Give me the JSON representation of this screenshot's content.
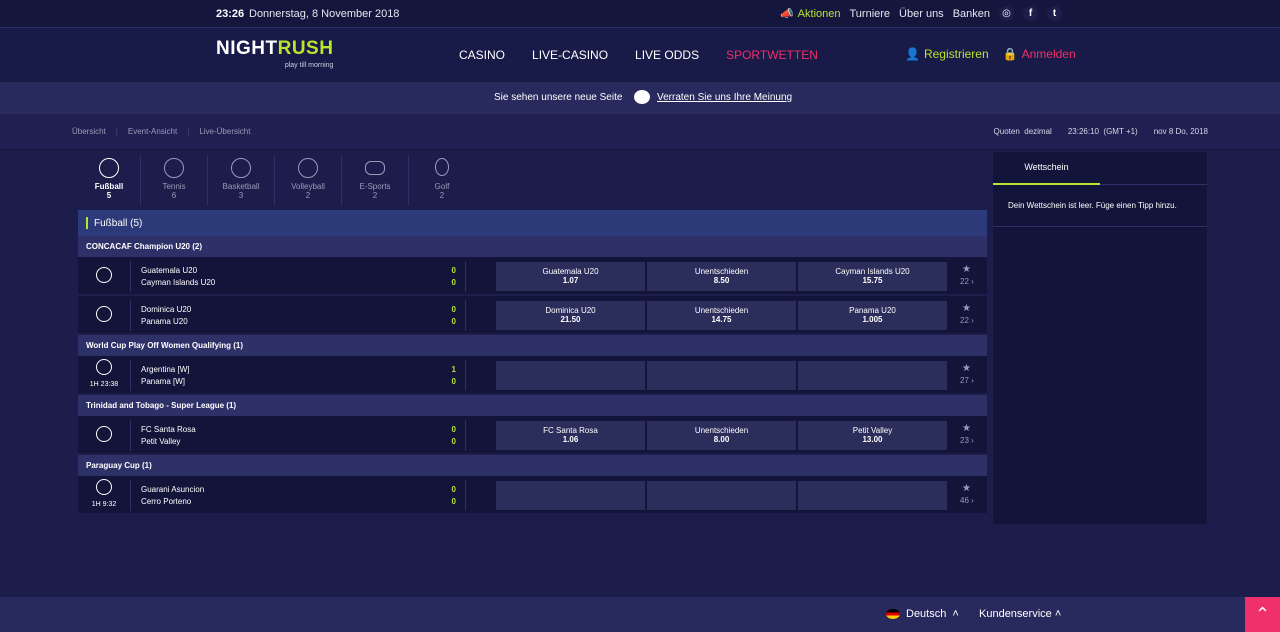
{
  "topbar": {
    "time": "23:26",
    "date": "Donnerstag, 8 November 2018",
    "links": {
      "aktionen": "Aktionen",
      "turniere": "Turniere",
      "ueber_uns": "Über uns",
      "banken": "Banken"
    }
  },
  "header": {
    "logo_night": "NIGHT",
    "logo_rush": "RUSH",
    "tagline": "play till morning",
    "nav": [
      "CASINO",
      "LIVE-CASINO",
      "LIVE ODDS",
      "SPORTWETTEN"
    ],
    "register": "Registrieren",
    "login": "Anmelden"
  },
  "notice": {
    "message": "Sie sehen unsere neue Seite",
    "feedback": "Verraten Sie uns Ihre Meinung"
  },
  "subnav": {
    "crumbs": [
      "Übersicht",
      "Event-Ansicht",
      "Live-Übersicht"
    ],
    "quoten": "Quoten",
    "format": "dezimal",
    "clock": "23:26:10",
    "tz": "(GMT +1)",
    "date": "nov 8 Do, 2018"
  },
  "sports": [
    {
      "label": "Fußball",
      "count": "5"
    },
    {
      "label": "Tennis",
      "count": "6"
    },
    {
      "label": "Basketball",
      "count": "3"
    },
    {
      "label": "Volleyball",
      "count": "2"
    },
    {
      "label": "E-Sports",
      "count": "2"
    },
    {
      "label": "Golf",
      "count": "2"
    }
  ],
  "section_title": "Fußball (5)",
  "competitions": {
    "c1": "CONCACAF Champion U20 (2)",
    "c2": "World Cup Play Off Women Qualifying (1)",
    "c3": "Trinidad and Tobago - Super League (1)",
    "c4": "Paraguay Cup (1)"
  },
  "events": [
    {
      "home": "Guatemala U20",
      "away": "Cayman Islands U20",
      "s1": "0",
      "s2": "0",
      "clock": "",
      "odds": [
        {
          "n": "Guatemala U20",
          "v": "1.07"
        },
        {
          "n": "Unentschieden",
          "v": "8.50"
        },
        {
          "n": "Cayman Islands U20",
          "v": "15.75"
        }
      ],
      "more": "22"
    },
    {
      "home": "Dominica U20",
      "away": "Panama U20",
      "s1": "0",
      "s2": "0",
      "clock": "",
      "odds": [
        {
          "n": "Dominica U20",
          "v": "21.50"
        },
        {
          "n": "Unentschieden",
          "v": "14.75"
        },
        {
          "n": "Panama U20",
          "v": "1.005"
        }
      ],
      "more": "22"
    },
    {
      "home": "Argentina [W]",
      "away": "Panama [W]",
      "s1": "1",
      "s2": "0",
      "clock": "1H 23:38",
      "odds": [
        {
          "n": "",
          "v": ""
        },
        {
          "n": "",
          "v": ""
        },
        {
          "n": "",
          "v": ""
        }
      ],
      "more": "27"
    },
    {
      "home": "FC Santa Rosa",
      "away": "Petit Valley",
      "s1": "0",
      "s2": "0",
      "clock": "",
      "odds": [
        {
          "n": "FC Santa Rosa",
          "v": "1.06"
        },
        {
          "n": "Unentschieden",
          "v": "8.00"
        },
        {
          "n": "Petit Valley",
          "v": "13.00"
        }
      ],
      "more": "23"
    },
    {
      "home": "Guarani Asuncion",
      "away": "Cerro Porteno",
      "s1": "0",
      "s2": "0",
      "clock": "1H 9:32",
      "odds": [
        {
          "n": "",
          "v": ""
        },
        {
          "n": "",
          "v": ""
        },
        {
          "n": "",
          "v": ""
        }
      ],
      "more": "46"
    }
  ],
  "betslip": {
    "tab": "Wettschein",
    "empty": "Dein Wettschein ist leer. Füge einen Tipp hinzu."
  },
  "footer": {
    "language": "Deutsch",
    "service": "Kundenservice"
  },
  "colors": {
    "accent_green": "#b8e62e",
    "accent_pink": "#f0306a",
    "bg": "#1d1d4b"
  }
}
